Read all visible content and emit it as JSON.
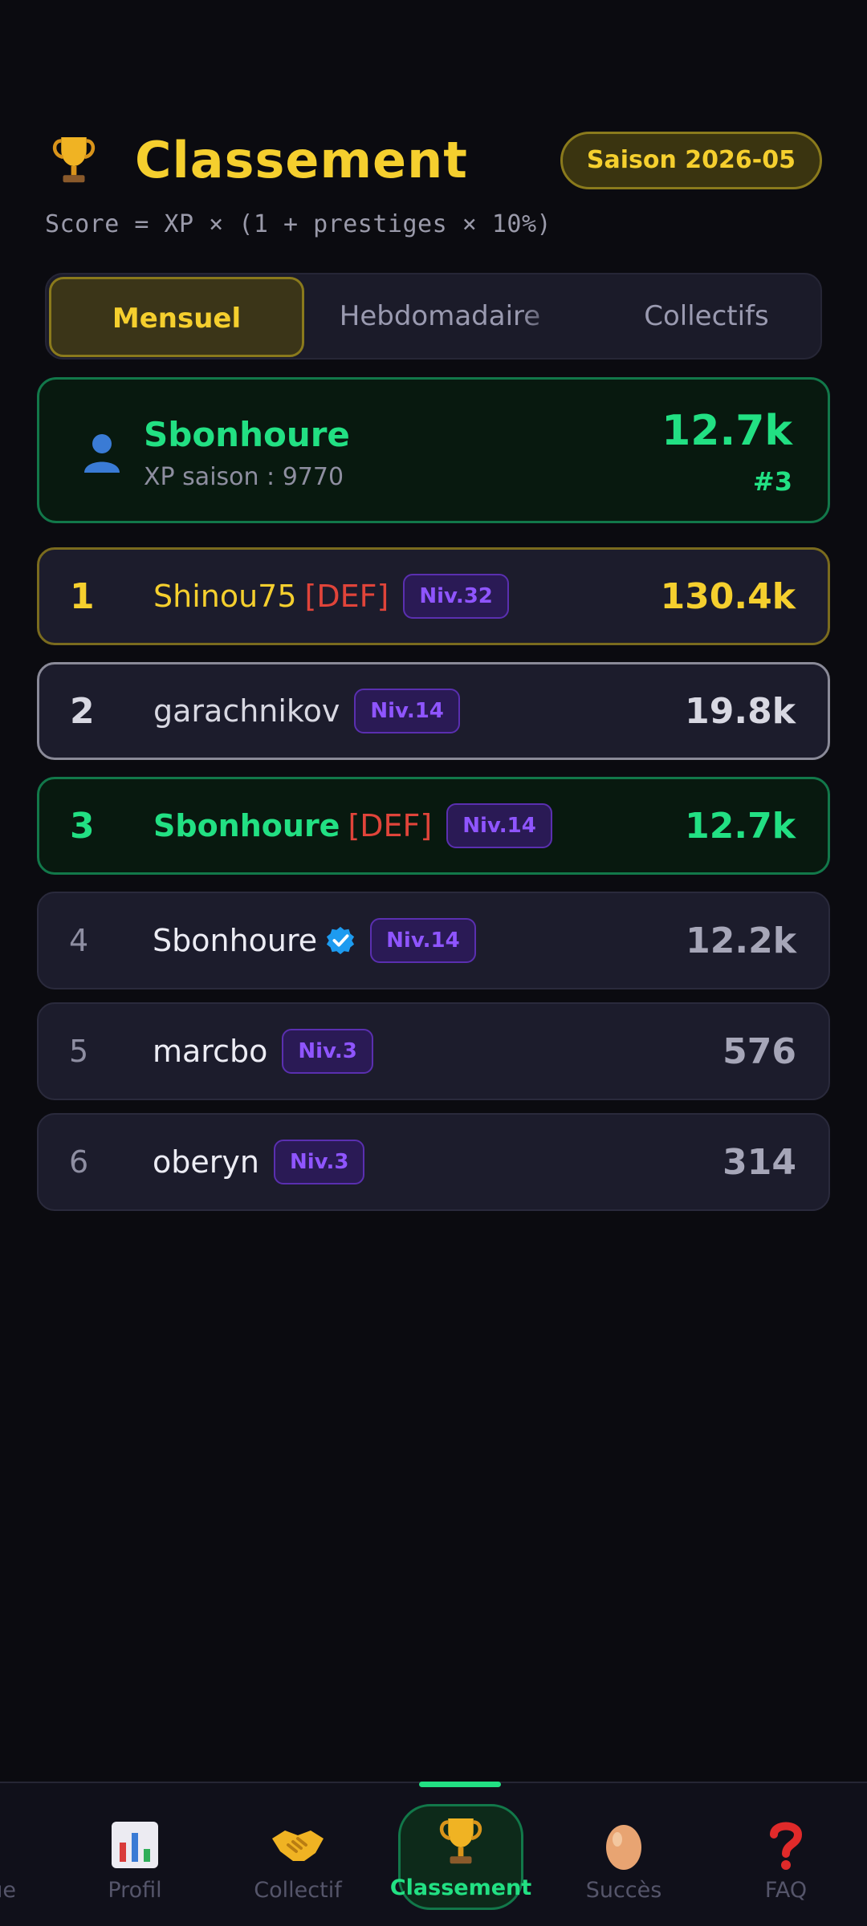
{
  "header": {
    "title": "Classement",
    "season": "Saison 2026-05",
    "formula": "Score = XP × (1 + prestiges × 10%)"
  },
  "tabs": [
    {
      "label": "Mensuel",
      "active": true
    },
    {
      "label": "Hebdomadaire",
      "active": false
    },
    {
      "label": "Collectifs",
      "active": false
    }
  ],
  "me": {
    "name": "Sbonhoure",
    "xp_label": "XP saison : 9770",
    "score": "12.7k",
    "rank": "#3"
  },
  "ranking": [
    {
      "rank": "1",
      "name": "Shinou75",
      "tag": "[DEF]",
      "level": "Niv.32",
      "score": "130.4k"
    },
    {
      "rank": "2",
      "name": "garachnikov",
      "tag": "",
      "level": "Niv.14",
      "score": "19.8k"
    },
    {
      "rank": "3",
      "name": "Sbonhoure",
      "tag": "[DEF]",
      "level": "Niv.14",
      "score": "12.7k"
    },
    {
      "rank": "4",
      "name": "Sbonhoure",
      "tag": "",
      "level": "Niv.14",
      "score": "12.2k",
      "verified": true
    },
    {
      "rank": "5",
      "name": "marcbo",
      "tag": "",
      "level": "Niv.3",
      "score": "576"
    },
    {
      "rank": "6",
      "name": "oberyn",
      "tag": "",
      "level": "Niv.3",
      "score": "314"
    }
  ],
  "nav": {
    "cut_label": "ue",
    "items": [
      {
        "label": "Profil",
        "icon": "bar-chart-icon"
      },
      {
        "label": "Collectif",
        "icon": "handshake-icon"
      },
      {
        "label": "Classement",
        "icon": "trophy-icon",
        "active": true
      },
      {
        "label": "Succès",
        "icon": "egg-icon"
      },
      {
        "label": "FAQ",
        "icon": "question-icon"
      }
    ]
  },
  "colors": {
    "accent_gold": "#f5cf2e",
    "accent_green": "#22e083",
    "level_purple": "#8f55ff",
    "def_red": "#e0443a"
  }
}
